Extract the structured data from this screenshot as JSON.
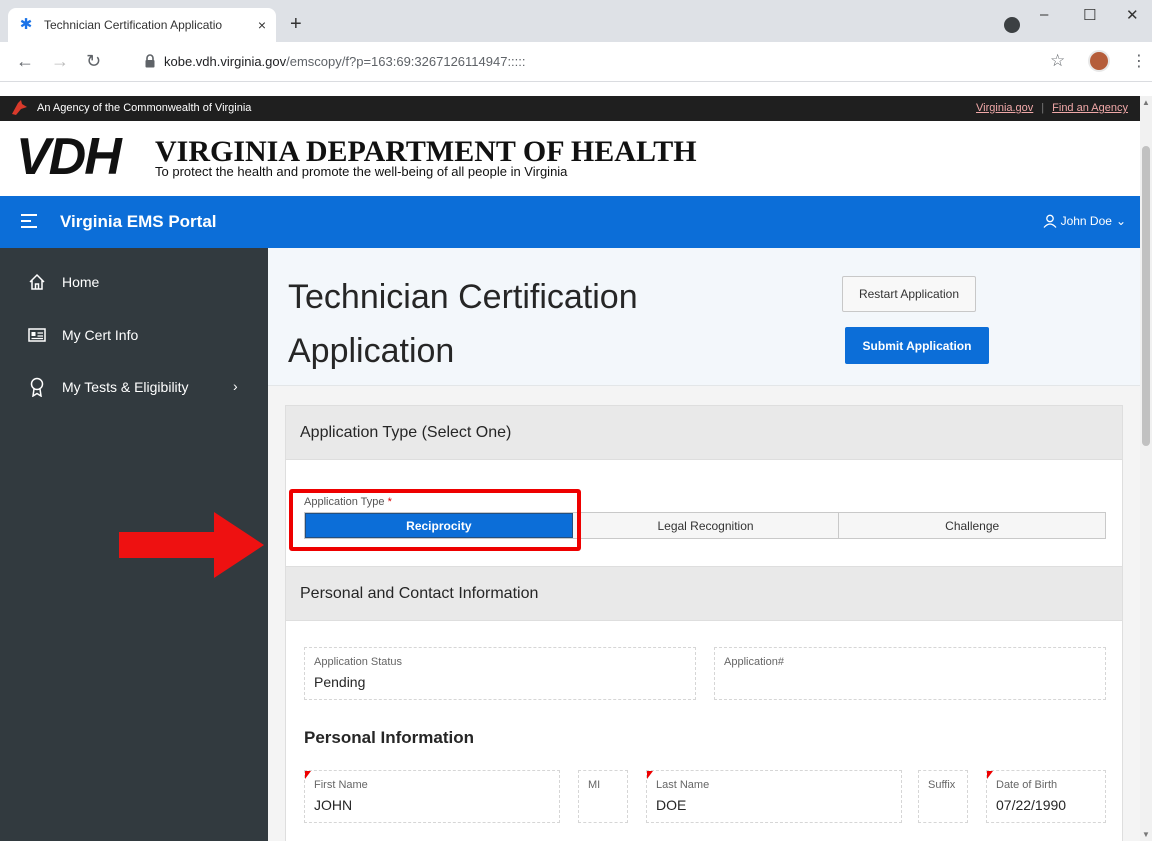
{
  "browser": {
    "tab_title": "Technician Certification Applicatio",
    "new_tab": "+",
    "tab_close": "×",
    "url_host": "kobe.vdh.virginia.gov",
    "url_path": "/emscopy/f?p=163:69:3267126114947:::::",
    "win_min": "–",
    "win_max": "☐",
    "win_close": "✕"
  },
  "agency_bar": {
    "text": "An Agency of the Commonwealth of Virginia",
    "link1": "Virginia.gov",
    "link2": "Find an Agency"
  },
  "vdh": {
    "logo": "VDH",
    "name": "VIRGINIA DEPARTMENT OF HEALTH",
    "tagline": "To protect the health and promote the well-being of all people in Virginia"
  },
  "appbar": {
    "title": "Virginia EMS Portal",
    "user": "John Doe"
  },
  "sidebar": {
    "items": [
      {
        "label": "Home"
      },
      {
        "label": "My Cert Info"
      },
      {
        "label": "My Tests & Eligibility"
      }
    ]
  },
  "hero": {
    "title": "Technician Certification Application",
    "restart_label": "Restart Application",
    "submit_label": "Submit Application"
  },
  "app_type": {
    "region_title": "Application Type (Select One)",
    "field_label": "Application Type",
    "required": "*",
    "options": [
      "Reciprocity",
      "Legal Recognition",
      "Challenge"
    ],
    "selected": "Reciprocity"
  },
  "personal": {
    "region_title": "Personal and Contact Information",
    "status_label": "Application Status",
    "status_value": "Pending",
    "appnum_label": "Application#",
    "appnum_value": "",
    "subheading": "Personal Information",
    "first_name_label": "First Name",
    "first_name_value": "JOHN",
    "mi_label": "MI",
    "mi_value": "",
    "last_name_label": "Last Name",
    "last_name_value": "DOE",
    "suffix_label": "Suffix",
    "suffix_value": "",
    "dob_label": "Date of Birth",
    "dob_value": "07/22/1990"
  },
  "colors": {
    "brand_blue": "#0c6ed8",
    "sidebar": "#323a3f",
    "annotation_red": "#e00000"
  }
}
